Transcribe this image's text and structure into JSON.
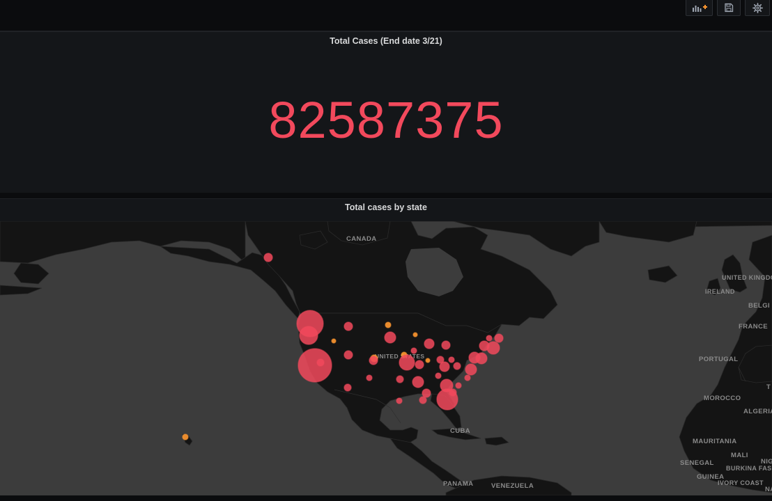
{
  "toolbar": {
    "add_panel_icon": "add-panel-icon",
    "save_icon": "save-icon",
    "settings_icon": "gear-icon"
  },
  "stat_panel": {
    "title": "Total Cases (End date 3/21)",
    "value": "82587375",
    "value_color": "#f2495c"
  },
  "map_panel": {
    "title": "Total cases by state",
    "labels": {
      "canada": "CANADA",
      "united_states": "UNITED STATES",
      "united_kingdom": "UNITED KINGDOM",
      "ireland": "IRELAND",
      "belgium": "BELGI",
      "france": "FRANCE",
      "portugal": "PORTUGAL",
      "morocco": "MOROCCO",
      "algeria": "ALGERIA",
      "mauritania": "MAURITANIA",
      "mali": "MALI",
      "senegal": "SENEGAL",
      "burkina_faso": "BURKINA FASO",
      "guinea": "GUINEA",
      "ivory_coast": "IVORY COAST",
      "cuba": "CUBA",
      "panama": "PANAMA",
      "venezuela": "VENEZUELA",
      "niger": "NIG",
      "edge_t": "T",
      "edge_na": "NA"
    },
    "colors": {
      "high": "#f2495c",
      "low": "#ff9830",
      "land": "#141414",
      "ocean": "#3c3c3c"
    }
  }
}
